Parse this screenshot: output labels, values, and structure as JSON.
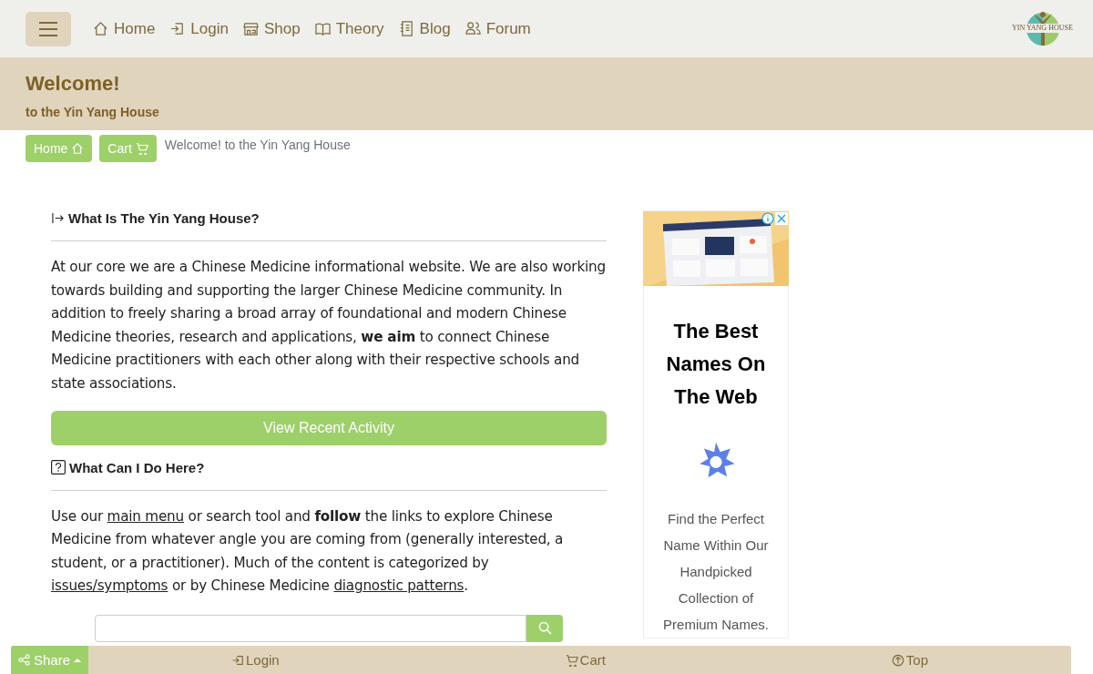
{
  "nav": {
    "items": [
      {
        "label": "Home"
      },
      {
        "label": "Login"
      },
      {
        "label": "Shop"
      },
      {
        "label": "Theory"
      },
      {
        "label": "Blog"
      },
      {
        "label": "Forum"
      }
    ],
    "logo_text": "YIN YANG HOUSE"
  },
  "banner": {
    "title": "Welcome!",
    "subtitle": "to the Yin Yang House"
  },
  "breadcrumb": {
    "buttons": [
      {
        "label": "Home"
      },
      {
        "label": "Cart"
      }
    ],
    "current": "Welcome! to the Yin Yang House"
  },
  "sections": [
    {
      "kind": "arrow",
      "heading": "What Is The Yin Yang House?",
      "paragraph": [
        {
          "kind": "text",
          "text": "At our core we are a Chinese Medicine informational website. We are also working towards building and supporting the larger Chinese Medicine community. In addition to freely sharing a broad array of foundational and modern Chinese Medicine theories, research and applications, **we aim** to connect Chinese Medicine practitioners with each other along with their respective schools and state associations."
        }
      ],
      "button": "View Recent Activity"
    },
    {
      "kind": "question",
      "heading": "What Can I Do Here?",
      "paragraph": [
        {
          "kind": "text",
          "text": "Use our "
        },
        {
          "kind": "link",
          "text": "main menu"
        },
        {
          "kind": "text",
          "text": " or search tool and **follow** the links to explore Chinese Medicine from whatever angle you are coming from (generally interested, a student, or a practitioner). Much of the content is categorized by "
        },
        {
          "kind": "link",
          "text": "issues/symptoms"
        },
        {
          "kind": "text",
          "text": " or by Chinese Medicine "
        },
        {
          "kind": "link",
          "text": "diagnostic patterns"
        },
        {
          "kind": "text",
          "text": "."
        }
      ]
    }
  ],
  "ad": {
    "headline": "The Best Names On The Web",
    "body": "Find the Perfect Name Within Our Handpicked Collection of Premium Names."
  },
  "footer": {
    "share": "Share",
    "items": [
      {
        "label": "Login"
      },
      {
        "label": "Cart"
      },
      {
        "label": "Top"
      }
    ]
  }
}
